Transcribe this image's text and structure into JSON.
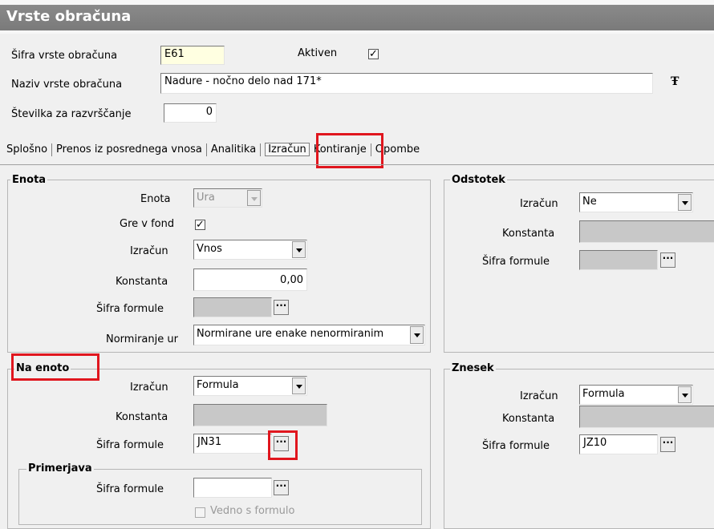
{
  "window": {
    "title": "Vrste obračuna"
  },
  "header": {
    "code_label": "Šifra vrste obračuna",
    "code_value": "E61",
    "active_label": "Aktiven",
    "active_checked": "✓",
    "name_label": "Naziv vrste obračuna",
    "name_value": "Nadure - nočno delo nad 171*",
    "font_icon": "Ŧ",
    "sort_label": "Številka  za razvrščanje",
    "sort_value": "0"
  },
  "tabs": [
    {
      "label": "Splošno",
      "active": false
    },
    {
      "label": "Prenos iz posrednega vnosa",
      "active": false
    },
    {
      "label": "Analitika",
      "active": false
    },
    {
      "label": "Izračun",
      "active": true
    },
    {
      "label": "Kontiranje",
      "active": false
    },
    {
      "label": "Opombe",
      "active": false
    }
  ],
  "enota": {
    "title": "Enota",
    "unit_label": "Enota",
    "unit_value": "Ura",
    "fund_label": "Gre v fond",
    "fund_checked": "✓",
    "calc_label": "Izračun",
    "calc_value": "Vnos",
    "const_label": "Konstanta",
    "const_value": "0,00",
    "formula_label": "Šifra formule",
    "formula_value": "",
    "norm_label": "Normiranje ur",
    "norm_value": "Normirane ure enake nenormiranim"
  },
  "na_enoto": {
    "title": "Na enoto",
    "calc_label": "Izračun",
    "calc_value": "Formula",
    "const_label": "Konstanta",
    "const_value": "",
    "formula_label": "Šifra formule",
    "formula_value": "JN31"
  },
  "primerjava": {
    "title": "Primerjava",
    "formula_label": "Šifra formule",
    "formula_value": "",
    "always_label": "Vedno s formulo"
  },
  "odstotek": {
    "title": "Odstotek",
    "calc_label": "Izračun",
    "calc_value": "Ne",
    "const_label": "Konstanta",
    "const_value": "",
    "formula_label": "Šifra formule",
    "formula_value": ""
  },
  "znesek": {
    "title": "Znesek",
    "calc_label": "Izračun",
    "calc_value": "Formula",
    "const_label": "Konstanta",
    "const_value": "",
    "formula_label": "Šifra formule",
    "formula_value": "JZ10"
  },
  "icons": {
    "ellipsis": "···"
  },
  "colors": {
    "highlight": "#e0161e",
    "titlebar": "#808080",
    "code_field": "#ffffe1"
  }
}
